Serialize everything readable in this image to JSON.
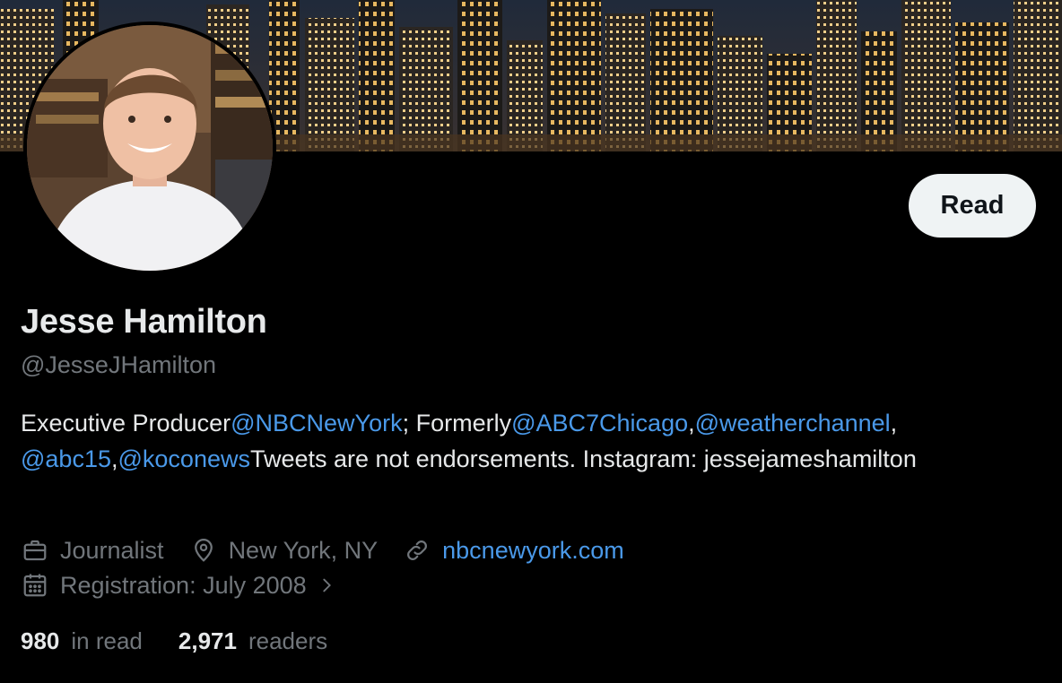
{
  "profile": {
    "name": "Jesse Hamilton",
    "handle": "@JesseJHamilton",
    "follow_button_label": "Read"
  },
  "bio": {
    "part1": "Executive Producer",
    "mention1": "@NBCNewYork",
    "part2": "; Formerly",
    "mention2": "@ABC7Chicago",
    "sep1": ",",
    "mention3": "@weatherchannel",
    "sep2": ",",
    "mention4": "@abc15",
    "sep3": ",",
    "mention5": "@koconews",
    "part3": "Tweets are not endorsements. Instagram: jessejameshamilton"
  },
  "meta": {
    "profession": "Journalist",
    "location": "New York, NY",
    "website": "nbcnewyork.com",
    "registration": "Registration: July 2008"
  },
  "stats": {
    "following_count": "980",
    "following_label": "in read",
    "followers_count": "2,971",
    "followers_label": "readers"
  },
  "colors": {
    "background": "#000000",
    "link": "#4a99e9",
    "muted": "#71767b",
    "button_bg": "#eff3f4"
  },
  "icons": {
    "profession": "briefcase-icon",
    "location": "location-pin-icon",
    "website": "link-icon",
    "registration": "calendar-icon",
    "registration_more": "chevron-right-icon"
  }
}
